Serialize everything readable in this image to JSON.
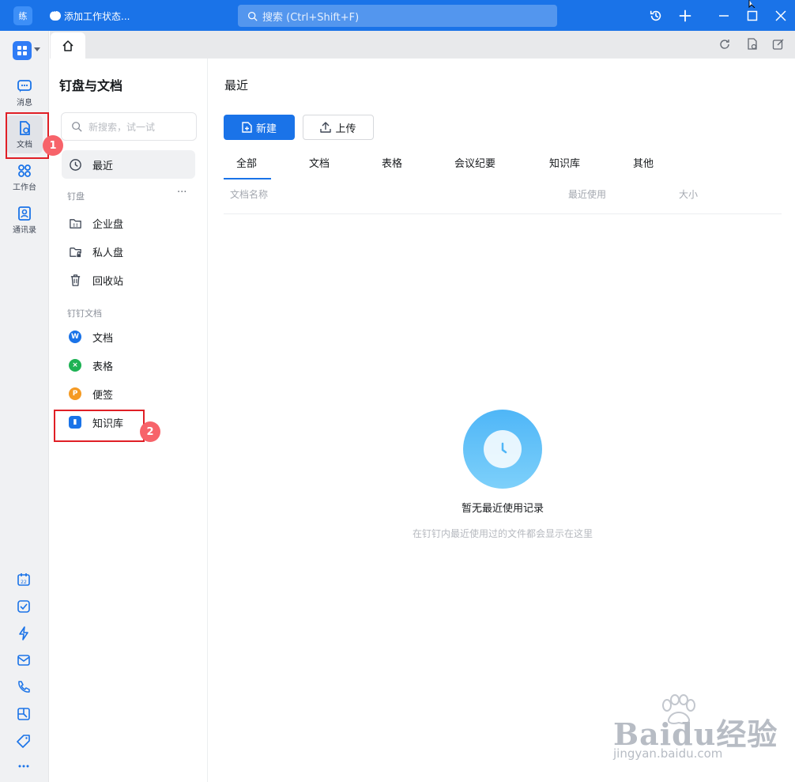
{
  "titlebar": {
    "avatar_text": "练",
    "status_text": "添加工作状态...",
    "search_placeholder": "搜索 (Ctrl+Shift+F)"
  },
  "rail": {
    "items": [
      {
        "label": "消息"
      },
      {
        "label": "文档"
      },
      {
        "label": "工作台"
      },
      {
        "label": "通讯录"
      }
    ]
  },
  "nav": {
    "title": "钉盘与文档",
    "search_placeholder": "新搜索，试一试",
    "recent": "最近",
    "section_drive": "钉盘",
    "more": "···",
    "drive_items": [
      "企业盘",
      "私人盘",
      "回收站"
    ],
    "section_docs": "钉钉文档",
    "doc_items": [
      "文档",
      "表格",
      "便签",
      "知识库"
    ]
  },
  "content": {
    "title": "最近",
    "new_label": "新建",
    "upload_label": "上传",
    "tabs": [
      "全部",
      "文档",
      "表格",
      "会议纪要",
      "知识库",
      "其他"
    ],
    "columns": [
      "文档名称",
      "最近使用",
      "大小"
    ],
    "empty_title": "暂无最近使用记录",
    "empty_sub": "在钉钉内最近使用过的文件都会显示在这里"
  },
  "annotations": {
    "badge1": "1",
    "badge2": "2"
  },
  "watermark": {
    "brand": "Baidu经验",
    "url": "jingyan.baidu.com"
  },
  "colors": {
    "brand_blue": "#1a73e8",
    "annotation_red": "#e01f26"
  }
}
